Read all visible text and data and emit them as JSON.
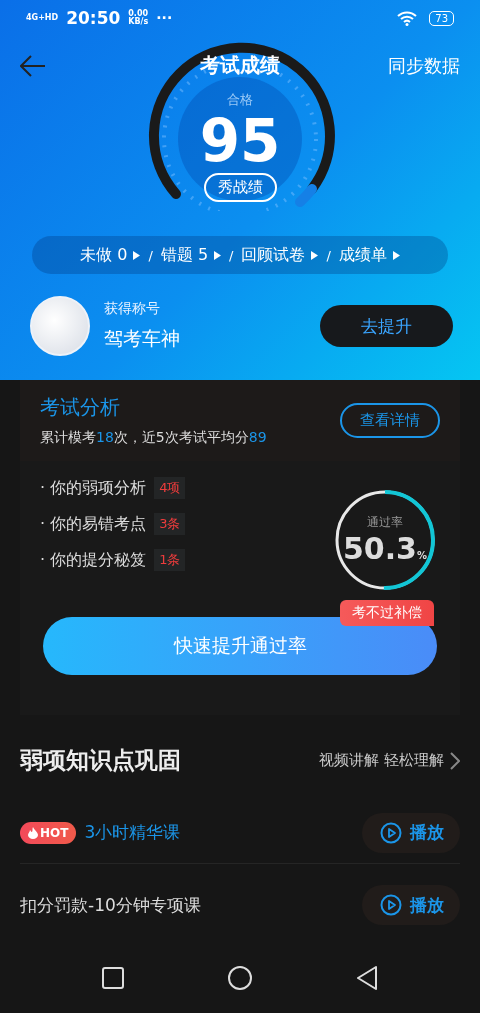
{
  "status_bar": {
    "network": "4G+HD",
    "time": "20:50",
    "speed": "0.00",
    "speed_unit": "KB/s",
    "more": "···",
    "battery": "73"
  },
  "header": {
    "title": "考试成绩",
    "action": "同步数据"
  },
  "score": {
    "result": "合格",
    "value": "95",
    "share_button": "秀战绩"
  },
  "shortcuts": [
    {
      "label": "未做 0",
      "separator": "/"
    },
    {
      "label": "错题  5",
      "separator": "/"
    },
    {
      "label": "回顾试卷",
      "separator": "/"
    },
    {
      "label": "成绩单"
    }
  ],
  "profile": {
    "caption": "获得称号",
    "title": "驾考车神",
    "button": "去提升"
  },
  "analysis": {
    "title": "考试分析",
    "summary": [
      {
        "text": "累计模考",
        "highlight": false
      },
      {
        "text": "18",
        "highlight": true
      },
      {
        "text": "次，近5次考试平均分",
        "highlight": false
      },
      {
        "text": "89",
        "highlight": true
      }
    ],
    "details_button": "查看详情",
    "items": [
      {
        "label": "· 你的弱项分析",
        "count": "4项"
      },
      {
        "label": "· 你的易错考点",
        "count": "3条"
      },
      {
        "label": "· 你的提分秘笈",
        "count": "1条"
      }
    ],
    "pass_rate": {
      "label": "通过率",
      "value": "50.3",
      "unit": "%",
      "level": 0.503
    },
    "cta": "快速提升通过率",
    "cta_tag": "考不过补偿"
  },
  "weak_points": {
    "title": "弱项知识点巩固",
    "link": "视频讲解 轻松理解",
    "courses": [
      {
        "badge": "HOT",
        "title": "3小时精华课",
        "featured": true,
        "play": "播放"
      },
      {
        "title": "扣分罚款-10分钟专项课",
        "featured": false,
        "play": "播放"
      }
    ]
  }
}
